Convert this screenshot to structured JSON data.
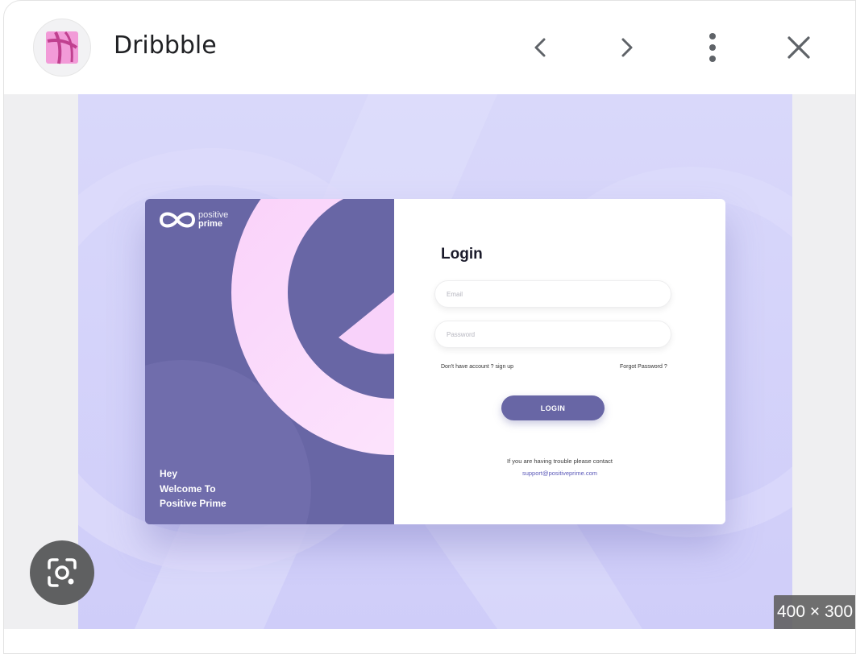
{
  "header": {
    "site_name": "Dribbble",
    "site_icon": "dribbble-logo-icon",
    "prev_icon": "chevron-left-icon",
    "next_icon": "chevron-right-icon",
    "more_icon": "more-vert-icon",
    "close_icon": "close-icon"
  },
  "preview": {
    "size_badge": "400 × 300",
    "lens_icon": "google-lens-icon",
    "mockup": {
      "brand_line1": "positive",
      "brand_line2": "prime",
      "welcome_lines": [
        "Hey",
        "Welcome To",
        "Positive Prime"
      ],
      "login_title": "Login",
      "email_placeholder": "Email",
      "password_placeholder": "Password",
      "signup_text": "Don't have account ? sign up",
      "forgot_text": "Forgot Password ?",
      "login_button": "LOGIN",
      "trouble_text": "If you are having trouble please contact",
      "support_email": "support@positiveprime.com"
    }
  },
  "colors": {
    "mockup_purple": "#6866a5",
    "background_lavender": "#d6d4fb",
    "accent_pink": "#fcd4fb"
  }
}
